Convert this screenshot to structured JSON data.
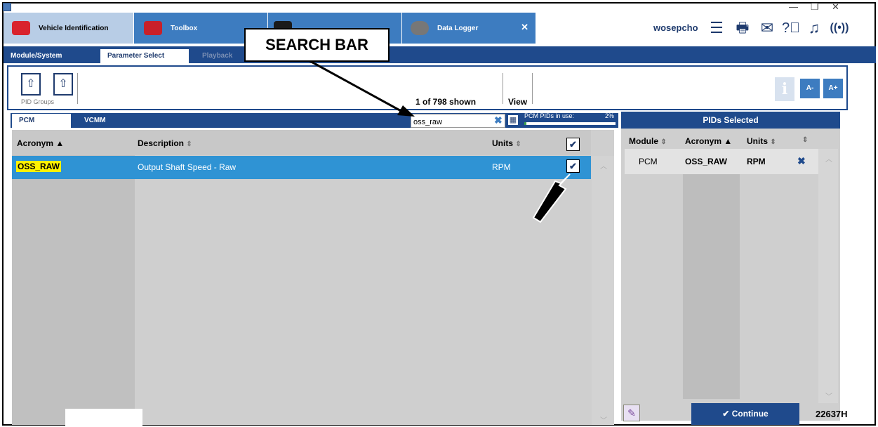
{
  "window": {
    "minimize": "—",
    "maximize": "❐",
    "close": "✕"
  },
  "top_tabs": [
    {
      "label": "Vehicle Identification",
      "icon": "car-icon"
    },
    {
      "label": "Toolbox",
      "icon": "toolbox-icon"
    },
    {
      "label": "",
      "icon": "scope-icon"
    },
    {
      "label": "Data Logger",
      "icon": "data-logger-icon",
      "close": "✕"
    }
  ],
  "header": {
    "user": "wosepcho"
  },
  "sub_tabs": [
    "Module/System",
    "Parameter Select",
    "Playback"
  ],
  "callout": "SEARCH BAR",
  "toolbar": {
    "pid_groups": "PID Groups",
    "shown": "1 of 798 shown",
    "view": "View",
    "info": "i",
    "smaller": "A-",
    "larger": "A+"
  },
  "module_tabs": [
    "PCM",
    "VCMM"
  ],
  "search": {
    "value": "oss_raw",
    "clear": "✖"
  },
  "pids_in_use": {
    "label": "PCM PIDs in use:",
    "percent": "2%",
    "fraction": 0.02
  },
  "table": {
    "headers": {
      "acronym": "Acronym",
      "description": "Description",
      "units": "Units"
    },
    "rows": [
      {
        "acronym": "OSS_RAW",
        "description": "Output Shaft Speed - Raw",
        "units": "RPM"
      }
    ]
  },
  "pids_selected": {
    "title": "PIDs Selected",
    "headers": {
      "module": "Module",
      "acronym": "Acronym",
      "units": "Units"
    },
    "rows": [
      {
        "module": "PCM",
        "acronym": "OSS_RAW",
        "units": "RPM"
      }
    ]
  },
  "continue_label": "Continue",
  "figure_code": "22637H",
  "colors": {
    "nav": "#1f4a8c",
    "tab": "#3d7cc0",
    "selected_row": "#2f93d4",
    "highlight": "#fff200"
  }
}
